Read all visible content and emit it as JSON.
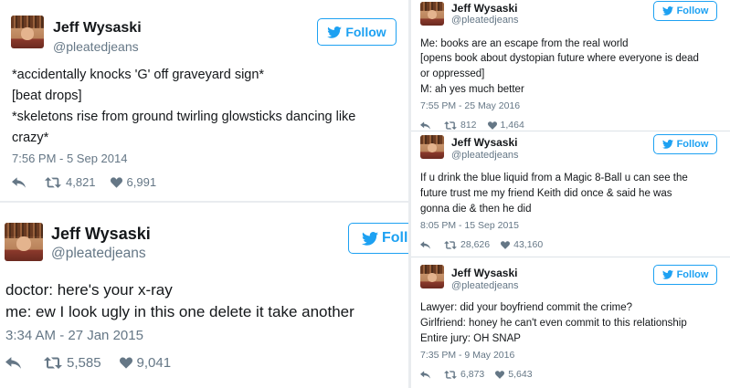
{
  "follow_label": "Follow",
  "follow_label_cut": "Foll",
  "colors": {
    "accent": "#1da1f2",
    "secondary": "#657786",
    "text": "#14171a"
  },
  "icons": {
    "reply": "reply-icon",
    "retweet": "retweet-icon",
    "like": "heart-icon",
    "brand": "bird-icon"
  },
  "tweets": [
    {
      "name": "Jeff Wysaski",
      "handle": "@pleatedjeans",
      "lines": [
        "*accidentally knocks 'G' off graveyard sign*",
        "[beat drops]",
        "*skeletons rise from ground twirling glowsticks dancing like",
        "crazy*"
      ],
      "time": "7:56 PM - 5 Sep 2014",
      "retweets": "4,821",
      "likes": "6,991"
    },
    {
      "name": "Jeff Wysaski",
      "handle": "@pleatedjeans",
      "lines": [
        "doctor: here's your x-ray",
        "me: ew I look ugly in this one delete it take another"
      ],
      "time": "3:34 AM - 27 Jan 2015",
      "retweets": "5,585",
      "likes": "9,041"
    },
    {
      "name": "Jeff Wysaski",
      "handle": "@pleatedjeans",
      "lines": [
        "Me: books are an escape from the real world",
        "[opens book about dystopian future where everyone is dead",
        "or oppressed]",
        "M: ah yes much better"
      ],
      "time": "7:55 PM - 25 May 2016",
      "retweets": "812",
      "likes": "1,464"
    },
    {
      "name": "Jeff Wysaski",
      "handle": "@pleatedjeans",
      "lines": [
        "If u drink the blue liquid from a Magic 8-Ball u can see the",
        "future trust me my friend Keith did once & said he was",
        "gonna die & then he did"
      ],
      "time": "8:05 PM - 15 Sep 2015",
      "retweets": "28,626",
      "likes": "43,160"
    },
    {
      "name": "Jeff Wysaski",
      "handle": "@pleatedjeans",
      "lines": [
        "Lawyer: did your boyfriend commit the crime?",
        "Girlfriend: honey he can't even commit to this relationship",
        "Entire jury: OH SNAP"
      ],
      "time": "7:35 PM - 9 May 2016",
      "retweets": "6,873",
      "likes": "5,643"
    }
  ]
}
